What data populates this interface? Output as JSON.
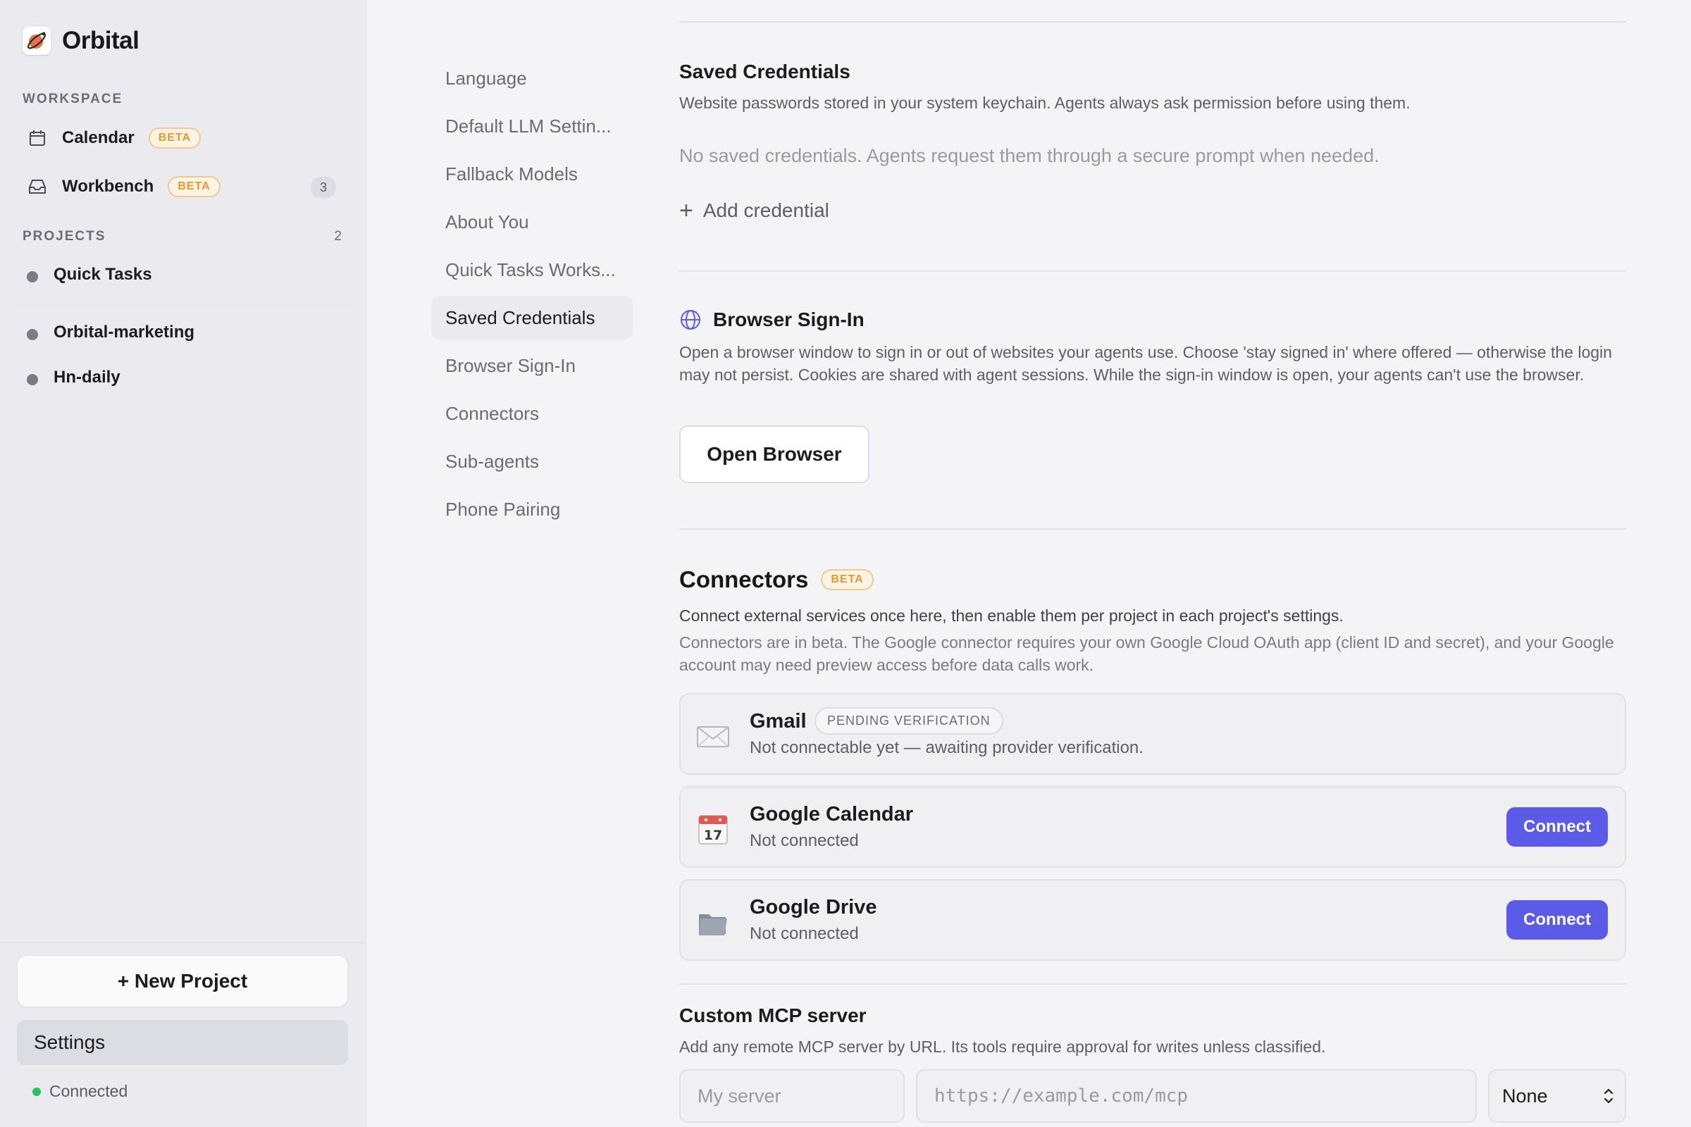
{
  "app": {
    "name": "Orbital"
  },
  "sidebar": {
    "workspace_label": "WORKSPACE",
    "workspace_items": [
      {
        "label": "Calendar",
        "badge": "BETA",
        "icon": "calendar-icon"
      },
      {
        "label": "Workbench",
        "badge": "BETA",
        "icon": "inbox-icon",
        "count": "3"
      }
    ],
    "projects_label": "PROJECTS",
    "projects_count": "2",
    "projects": [
      {
        "label": "Quick Tasks"
      },
      {
        "label": "Orbital-marketing"
      },
      {
        "label": "Hn-daily"
      }
    ],
    "new_project_label": "+ New Project",
    "settings_label": "Settings",
    "status_text": "Connected",
    "status_color": "#22c55e"
  },
  "settings_nav": {
    "items": [
      "Language",
      "Default LLM Settin...",
      "Fallback Models",
      "About You",
      "Quick Tasks Works...",
      "Saved Credentials",
      "Browser Sign-In",
      "Connectors",
      "Sub-agents",
      "Phone Pairing"
    ],
    "active": "Saved Credentials"
  },
  "saved_credentials": {
    "title": "Saved Credentials",
    "description": "Website passwords stored in your system keychain. Agents always ask permission before using them.",
    "empty_text": "No saved credentials. Agents request them through a secure prompt when needed.",
    "add_label": "Add credential"
  },
  "browser_signin": {
    "title": "Browser Sign-In",
    "description": "Open a browser window to sign in or out of websites your agents use. Choose 'stay signed in' where offered — otherwise the login may not persist. Cookies are shared with agent sessions. While the sign-in window is open, your agents can't use the browser.",
    "button_label": "Open Browser"
  },
  "connectors": {
    "title": "Connectors",
    "badge": "BETA",
    "description": "Connect external services once here, then enable them per project in each project's settings.",
    "note": "Connectors are in beta. The Google connector requires your own Google Cloud OAuth app (client ID and secret), and your Google account may need preview access before data calls work.",
    "items": [
      {
        "name": "Gmail",
        "status": "Not connectable yet — awaiting provider verification.",
        "badge": "PENDING VERIFICATION",
        "icon": "envelope-icon"
      },
      {
        "name": "Google Calendar",
        "status": "Not connected",
        "button": "Connect",
        "icon": "calendar-17-icon"
      },
      {
        "name": "Google Drive",
        "status": "Not connected",
        "button": "Connect",
        "icon": "folder-icon"
      }
    ],
    "accent_color": "#5b5be8"
  },
  "custom_mcp": {
    "title": "Custom MCP server",
    "description": "Add any remote MCP server by URL. Its tools require approval for writes unless classified.",
    "name_placeholder": "My server",
    "url_placeholder": "https://example.com/mcp",
    "select_value": "None"
  }
}
